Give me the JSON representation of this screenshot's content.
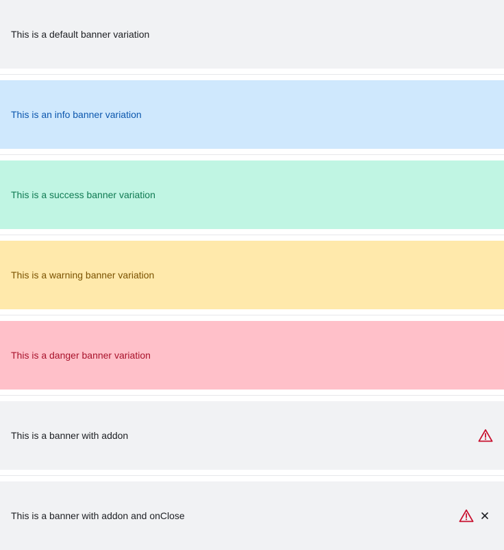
{
  "banners": [
    {
      "text": "This is a default banner variation",
      "variant": "default"
    },
    {
      "text": "This is an info banner variation",
      "variant": "info"
    },
    {
      "text": "This is a success banner variation",
      "variant": "success"
    },
    {
      "text": "This is a warning banner variation",
      "variant": "warning"
    },
    {
      "text": "This is a danger banner variation",
      "variant": "danger"
    },
    {
      "text": "This is a banner with addon",
      "variant": "default",
      "addon_icon": "warning-triangle-icon"
    },
    {
      "text": "This is a banner with addon and onClose",
      "variant": "default",
      "addon_icon": "warning-triangle-icon",
      "close_icon": "close-icon"
    }
  ],
  "colors": {
    "default_bg": "#f1f2f4",
    "info_bg": "#cfe8fd",
    "info_text": "#0b56ad",
    "success_bg": "#c0f5e3",
    "success_text": "#0f7a52",
    "warning_bg": "#ffe9ab",
    "warning_text": "#7a5200",
    "danger_bg": "#ffc0c9",
    "danger_text": "#a8122b",
    "addon_icon": "#c8102e"
  }
}
